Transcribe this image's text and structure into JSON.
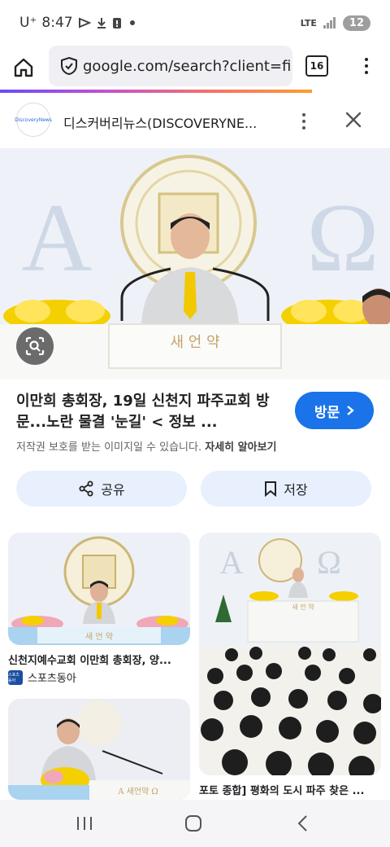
{
  "status_bar": {
    "carrier": "U⁺",
    "time": "8:47",
    "network": "LTE",
    "battery": "12"
  },
  "browser": {
    "url": "google.com/search?client=fire",
    "tab_count": "16",
    "load_progress": 0.8
  },
  "viewer": {
    "site_name": "디스커버리뉴스(DISCOVERYNE...",
    "site_logo_text": "DiscoveryNews",
    "title": "이만희 총회장, 19일 신천지 파주교회 방문...노란 물결 '눈길' < 정보 ...",
    "visit_label": "방문",
    "copyright_text": "저작권 보호를 받는 이미지일 수 있습니다.",
    "learn_more": "자세히 알아보기",
    "share_label": "공유",
    "save_label": "저장",
    "image": {
      "letter_alpha": "A",
      "letter_omega": "Ω",
      "podium_text": "새 언 약"
    }
  },
  "related": [
    {
      "caption": "신천지예수교회 이만희 총회장, 양...",
      "source": "스포츠동아",
      "source_logo_text": "스포츠동아",
      "podium_text": "새 언 약"
    },
    {
      "caption": "포토 종합] 평화의 도시 파주 찾은 ...",
      "podium_text": "새 언 약"
    },
    {
      "podium_text": "A 새언약 Ω"
    }
  ],
  "colors": {
    "accent": "#1a73e8",
    "pill_bg": "#e8f0fe",
    "flowers": "#f5d000"
  }
}
